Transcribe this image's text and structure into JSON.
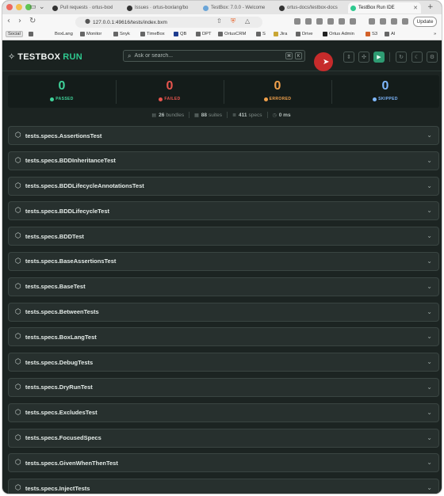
{
  "browser": {
    "tabs": [
      {
        "title": "Pull requests · ortus-boxl",
        "active": false
      },
      {
        "title": "Issues · ortus-boxlang/bo",
        "active": false
      },
      {
        "title": "TestBox: 7.0.0 - Welcome",
        "active": false
      },
      {
        "title": "ortus-docs/testbox-docs",
        "active": false
      },
      {
        "title": "TestBox Run IDE",
        "active": true
      }
    ],
    "new_tab": "+",
    "url": "127.0.0.1:49616/tests/index.bxm",
    "update_label": "Update"
  },
  "bookmarks": [
    "Social",
    "BoxLang",
    "Monitor",
    "Snyk",
    "TimeBox",
    "QB",
    "DPT",
    "OrtusCRM",
    "S",
    "Jira",
    "Drive",
    "Ortus Admin",
    "S3",
    "AI"
  ],
  "app": {
    "logo_a": "TESTBOX",
    "logo_b": "RUN",
    "search_placeholder": "Ask or search...",
    "kbd_1": "⌘",
    "kbd_2": "K"
  },
  "stats": [
    {
      "value": "0",
      "label": "PASSED",
      "color": "#3fd39a"
    },
    {
      "value": "0",
      "label": "FAILED",
      "color": "#e8554e"
    },
    {
      "value": "0",
      "label": "ERRORED",
      "color": "#f0a04b"
    },
    {
      "value": "0",
      "label": "SKIPPED",
      "color": "#7fb8ff"
    }
  ],
  "summary": {
    "bundles_count": "26",
    "bundles_label": "bundles",
    "suites_count": "88",
    "suites_label": "suites",
    "specs_count": "411",
    "specs_label": "specs",
    "time": "0 ms"
  },
  "bundles": [
    "tests.specs.AssertionsTest",
    "tests.specs.BDDInheritanceTest",
    "tests.specs.BDDLifecycleAnnotationsTest",
    "tests.specs.BDDLifecycleTest",
    "tests.specs.BDDTest",
    "tests.specs.BaseAssertionsTest",
    "tests.specs.BaseTest",
    "tests.specs.BetweenTests",
    "tests.specs.BoxLangTest",
    "tests.specs.DebugTests",
    "tests.specs.DryRunTest",
    "tests.specs.ExcludesTest",
    "tests.specs.FocusedSpecs",
    "tests.specs.GivenWhenThenTest",
    "tests.specs.InjectTests"
  ]
}
